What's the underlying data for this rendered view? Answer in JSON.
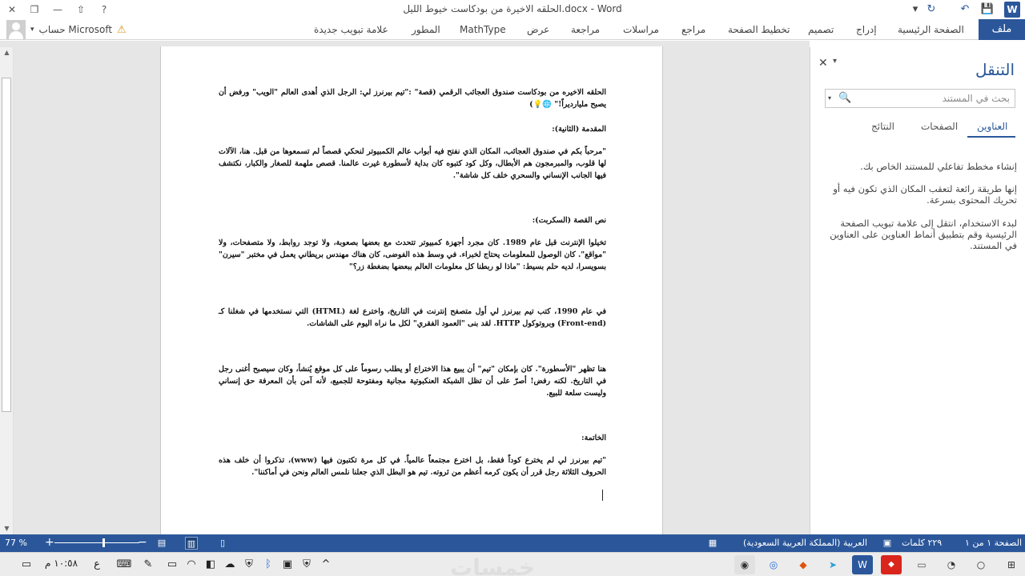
{
  "window": {
    "title": "الحلقه الاخيرة من بودكاست خيوط الليل.docx - Word",
    "controls": {
      "help": "?",
      "restore_ribbon": "⇧",
      "minimize": "—",
      "maximize": "❐",
      "close": "✕"
    }
  },
  "qat": {
    "save": "💾",
    "undo": "↶",
    "redo": "↻",
    "customize": "▾"
  },
  "app_logo": "W",
  "ribbon": {
    "file": "ملف",
    "tabs": [
      "الصفحة الرئيسية",
      "إدراج",
      "تصميم",
      "تخطيط الصفحة",
      "مراجع",
      "مراسلات",
      "مراجعة",
      "عرض",
      "MathType",
      "المطور",
      "علامة تبويب جديدة"
    ],
    "account_label": "حساب Microsoft",
    "account_caret": "▾",
    "warning_icon": "⚠"
  },
  "document": {
    "paragraphs": [
      "الحلقه الاخيره من بودكاست صندوق العجائب الرقمي (قصة\" :\"تيم بيرنرز لي: الرجل الذي أهدى العالم \"الويب\" ورفض أن يصبح مليارديراً!\" 🌐💡)",
      "المقدمة (الثانية):",
      "\"مرحباً بكم في صندوق العجائب، المكان الذي نفتح فيه أبواب عالم الكمبيوتر لنحكي قصصاً لم تسمعوها من قبل. هنا، الآلات لها قلوب، والمبرمجون هم الأبطال، وكل كود كتبوه كان بداية لأسطورة غيرت عالمنا. قصص ملهمة للصغار والكبار، نكتشف فيها الجانب الإنساني والسحري خلف كل شاشة\".",
      "نص القصة (السكربت):",
      "تخيلوا الإنترنت قبل عام 1989. كان مجرد أجهزة كمبيوتر تتحدث مع بعضها بصعوبة، ولا توجد روابط، ولا متصفحات، ولا \"مواقع\". كان الوصول للمعلومات يحتاج لخبراء. في وسط هذه الفوضى، كان هناك مهندس بريطاني يعمل في مختبر \"سيرن\" بسويسرا، لديه حلم بسيط: \"ماذا لو ربطنا كل معلومات العالم ببعضها بضغطة زر؟\"",
      "في عام 1990، كتب تيم بيرنرز لي أول متصفح إنترنت في التاريخ، واخترع لغة (HTML) التي نستخدمها في شغلنا كـ (Front-end) وبروتوكول HTTP. لقد بنى \"العمود الفقري\" لكل ما نراه اليوم على الشاشات.",
      "هنا تظهر \"الأسطورة\". كان بإمكان \"تيم\" أن يبيع هذا الاختراع أو يطلب رسوماً على كل موقع يُنشأ، وكان سيصبح أغنى رجل في التاريخ. لكنه رفض! أصرّ على أن تظل الشبكة العنكبوتية مجانية ومفتوحة للجميع، لأنه آمن بأن المعرفة حق إنساني وليست سلعة للبيع.",
      "الخاتمة:",
      "\"تيم بيرنرز لي لم يخترع كوداً فقط، بل اخترع مجتمعاً عالمياً. في كل مرة تكتبون فيها (www)، تذكروا أن خلف هذه الحروف الثلاثة رجل قرر أن يكون كرمه أعظم من ثروته. تيم هو البطل الذي جعلنا نلمس العالم ونحن في أماكننا\"."
    ]
  },
  "nav_pane": {
    "title": "التنقل",
    "close": "✕",
    "menu": "▾",
    "search_placeholder": "بحث في المستند",
    "search_icon": "🔍",
    "search_dropdown": "▾",
    "tabs": {
      "headings": "العناوين",
      "pages": "الصفحات",
      "results": "النتائج"
    },
    "info": [
      "إنشاء مخطط تفاعلي للمستند الخاص بك.",
      "إنها طريقة رائعة لتعقب المكان الذي تكون فيه أو تحريك المحتوى بسرعة.",
      "لبدء الاستخدام، انتقل إلى علامة تبويب الصفحة الرئيسية وقم بتطبيق أنماط العناوين على العناوين في المستند."
    ]
  },
  "statusbar": {
    "page": "الصفحة ١ من ١",
    "words": "٢٢٩ كلمات",
    "language": "العربية (المملكة العربية السعودية)",
    "zoom": "77 %",
    "zoom_minus": "−",
    "zoom_plus": "+",
    "zoom_level": 0.77
  },
  "taskbar": {
    "clock": "١٠:٥٨ م",
    "lang": "ع",
    "watermark": "خمسات"
  },
  "colors": {
    "brand": "#2b579a",
    "statusbar": "#2b579a"
  }
}
